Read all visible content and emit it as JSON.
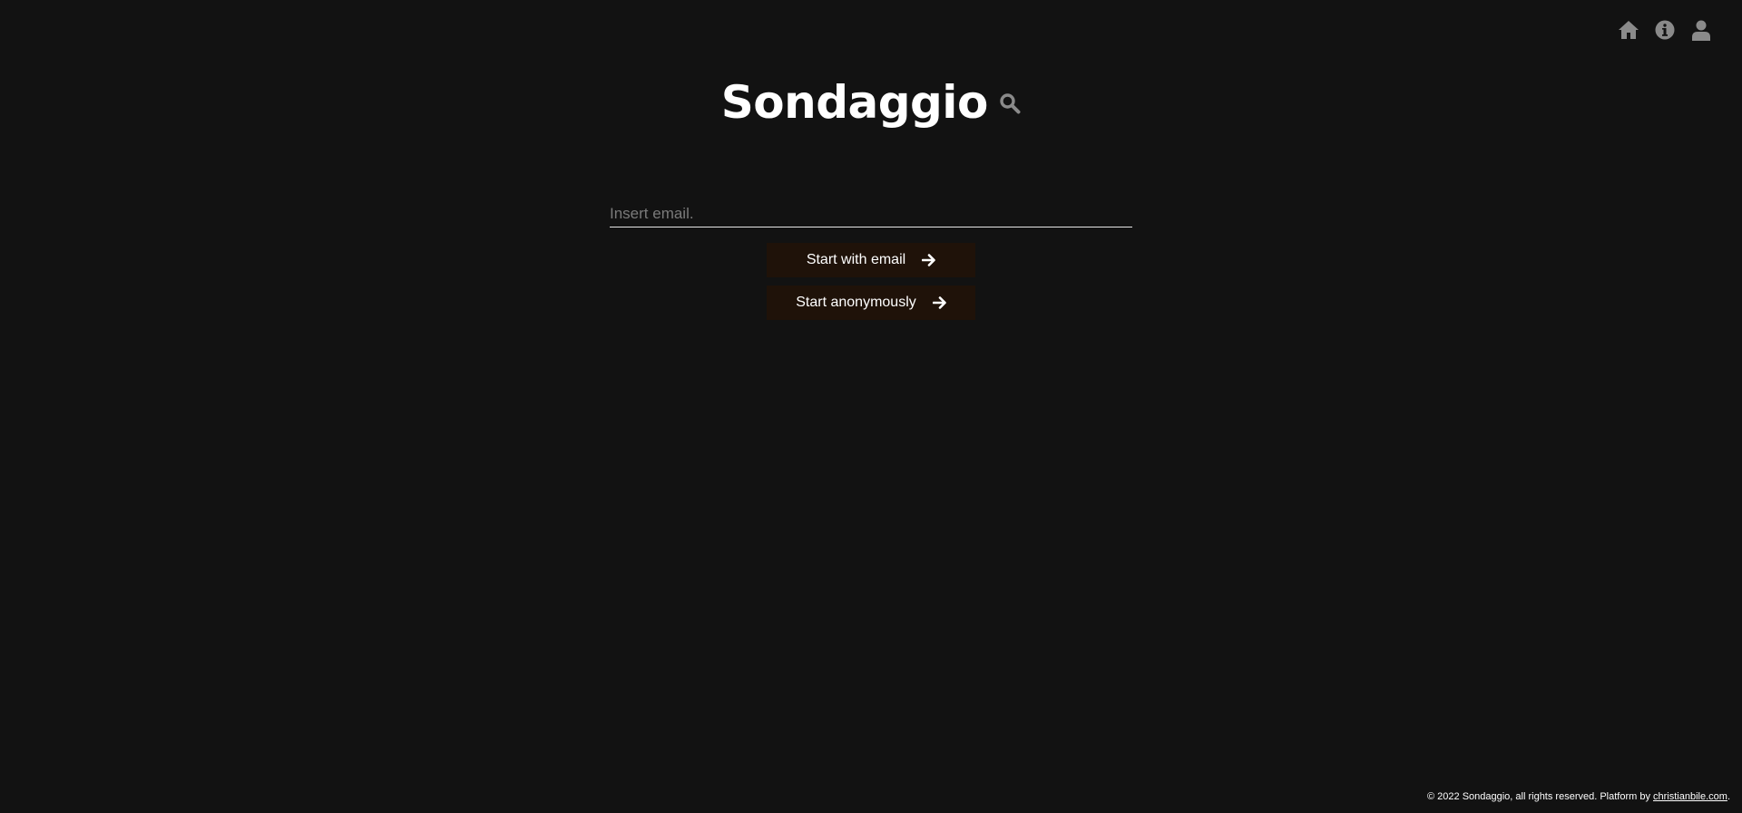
{
  "nav": {
    "items": [
      {
        "icon": "home-icon"
      },
      {
        "icon": "info-icon"
      },
      {
        "icon": "user-icon"
      }
    ]
  },
  "brand": {
    "title": "Sondaggio",
    "icon": "search-icon"
  },
  "form": {
    "email_placeholder": "Insert email.",
    "email_value": "",
    "start_email_label": "Start with email",
    "start_anon_label": "Start anonymously",
    "arrow_icon": "arrow-right-icon"
  },
  "footer": {
    "text": "© 2022 Sondaggio, all rights reserved. Platform by ",
    "link_label": "christianbile.com",
    "trailing": "."
  },
  "colors": {
    "background": "#121212",
    "button_bg": "#1f1209",
    "icon_gray": "#8a8a8a",
    "text": "#ffffff"
  }
}
